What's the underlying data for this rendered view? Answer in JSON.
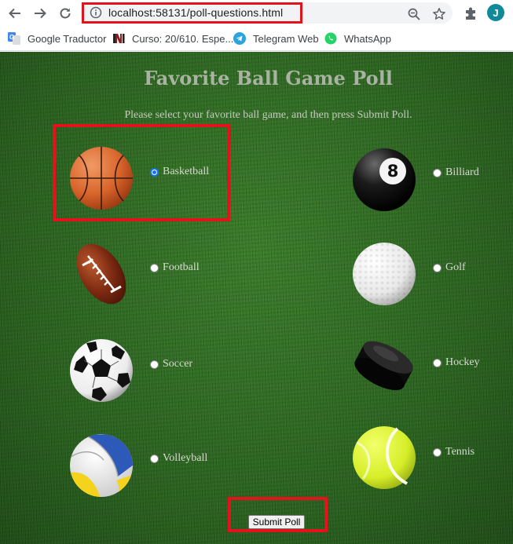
{
  "browser": {
    "url": "localhost:58131/poll-questions.html",
    "avatar_letter": "J",
    "bookmarks": [
      {
        "label": "Google Traductor",
        "icon": "google-translate-icon"
      },
      {
        "label": "Curso: 20/610. Espe...",
        "icon": "ni-logo-icon"
      },
      {
        "label": "Telegram Web",
        "icon": "telegram-icon"
      },
      {
        "label": "WhatsApp",
        "icon": "whatsapp-icon"
      }
    ]
  },
  "poll": {
    "title": "Favorite Ball Game Poll",
    "instructions": "Please select your favorite ball game, and then press Submit Poll.",
    "options": [
      {
        "label": "Basketball",
        "checked": true
      },
      {
        "label": "Billiard",
        "checked": false
      },
      {
        "label": "Football",
        "checked": false
      },
      {
        "label": "Golf",
        "checked": false
      },
      {
        "label": "Soccer",
        "checked": false
      },
      {
        "label": "Hockey",
        "checked": false
      },
      {
        "label": "Volleyball",
        "checked": false
      },
      {
        "label": "Tennis",
        "checked": false
      }
    ],
    "submit_label": "Submit Poll"
  },
  "colors": {
    "highlight": "#e3121b",
    "selected_radio": "#1a73e8",
    "grass": "#2e6a22"
  }
}
